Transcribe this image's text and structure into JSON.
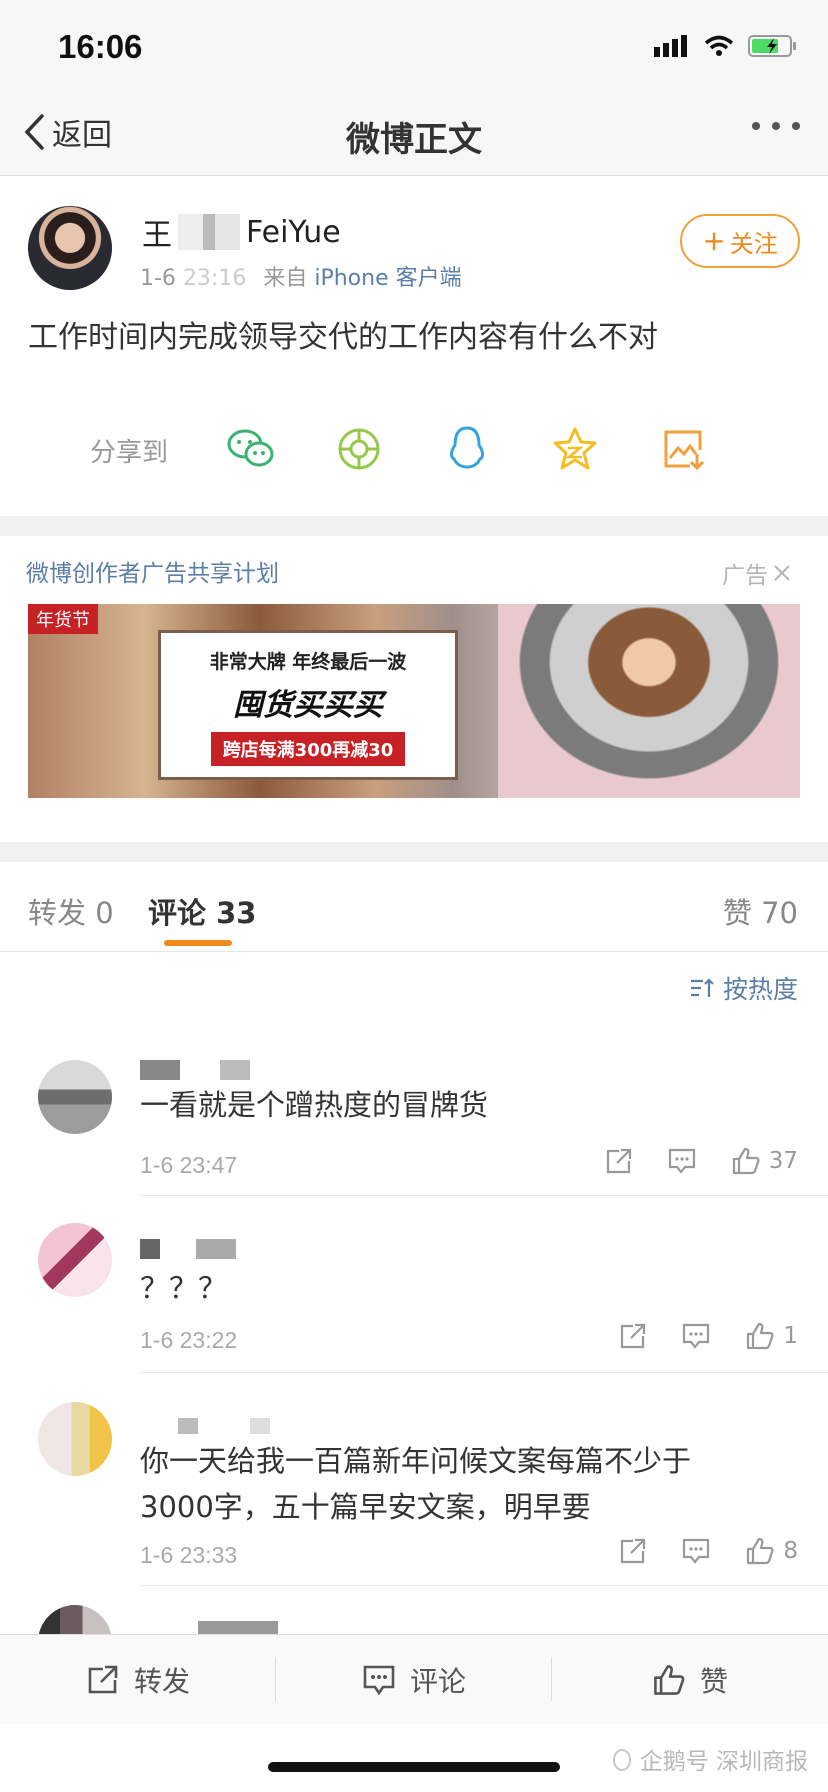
{
  "status_bar": {
    "time": "16:06"
  },
  "nav": {
    "back_label": "返回",
    "title": "微博正文"
  },
  "post": {
    "author_prefix": "王",
    "author_suffix": "FeiYue",
    "time_part1": "1-6",
    "time_part2": "23:16",
    "source_prefix": "来自",
    "source": "iPhone 客户端",
    "follow_label": "关注",
    "text": "工作时间内完成领导交代的工作内容有什么不对",
    "share_label": "分享到",
    "share_targets": [
      "wechat-icon",
      "moments-icon",
      "qq-icon",
      "qzone-icon",
      "save-image-icon"
    ]
  },
  "ad": {
    "label": "微博创作者广告共享计划",
    "tag": "广告",
    "banner_corner": "年货节",
    "banner_line1": "非常大牌 年终最后一波",
    "banner_line2": "囤货买买买",
    "banner_line3": "跨店每满300再减30"
  },
  "tabs": {
    "repost": "转发 0",
    "comments": "评论 33",
    "likes": "赞 70"
  },
  "sort_label": "按热度",
  "comments": [
    {
      "text": "一看就是个蹭热度的冒牌货",
      "time": "1-6 23:47",
      "likes": "37"
    },
    {
      "text": "？？？",
      "time": "1-6 23:22",
      "likes": "1"
    },
    {
      "text_line1": "你一天给我一百篇新年问候文案每篇不少于",
      "text_line2": "3000字，五十篇早安文案，明早要",
      "time": "1-6 23:33",
      "likes": "8"
    }
  ],
  "bottom_bar": {
    "repost": "转发",
    "comment": "评论",
    "like": "赞"
  },
  "watermark": "企鹅号 深圳商报",
  "colors": {
    "accent": "#f08a1c",
    "link": "#5b7fa8",
    "ad_red": "#c62125"
  }
}
